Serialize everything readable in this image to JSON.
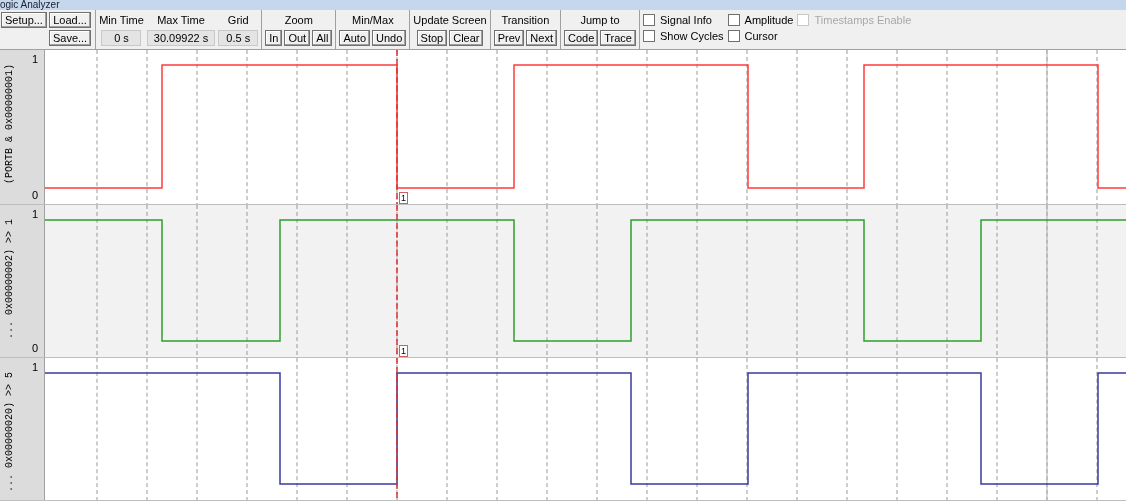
{
  "window": {
    "title": "ogic Analyzer"
  },
  "toolbar": {
    "setup_button": "Setup...",
    "load_button": "Load...",
    "save_button": "Save...",
    "fields": [
      {
        "label": "Min Time",
        "value": "0 s"
      },
      {
        "label": "Max Time",
        "value": "30.09922 s"
      },
      {
        "label": "Grid",
        "value": "0.5 s"
      }
    ],
    "button_groups": [
      {
        "label": "Zoom",
        "buttons": [
          "In",
          "Out",
          "All"
        ]
      },
      {
        "label": "Min/Max",
        "buttons": [
          "Auto",
          "Undo"
        ]
      },
      {
        "label": "Update Screen",
        "buttons": [
          "Stop",
          "Clear"
        ]
      },
      {
        "label": "Transition",
        "buttons": [
          "Prev",
          "Next"
        ]
      },
      {
        "label": "Jump to",
        "buttons": [
          "Code",
          "Trace"
        ]
      }
    ],
    "checkboxes": [
      {
        "label": "Signal Info",
        "checked": false,
        "disabled": false
      },
      {
        "label": "Amplitude",
        "checked": false,
        "disabled": false
      },
      {
        "label": "Timestamps Enable",
        "checked": false,
        "disabled": true
      },
      {
        "label": "Show Cycles",
        "checked": false,
        "disabled": false
      },
      {
        "label": "Cursor",
        "checked": false,
        "disabled": false
      }
    ]
  },
  "channels": [
    {
      "name": "(PORTB & 0x00000001)",
      "max": "1",
      "min": "0",
      "color": "#ff3b3b",
      "cursor_label": "1"
    },
    {
      "name": "... 0x00000002) >> 1",
      "max": "1",
      "min": "0",
      "color": "#2ea02e",
      "cursor_label": "1"
    },
    {
      "name": "... 0x00000020) >> 5",
      "max": "1",
      "color": "#3a3aa0"
    }
  ]
}
